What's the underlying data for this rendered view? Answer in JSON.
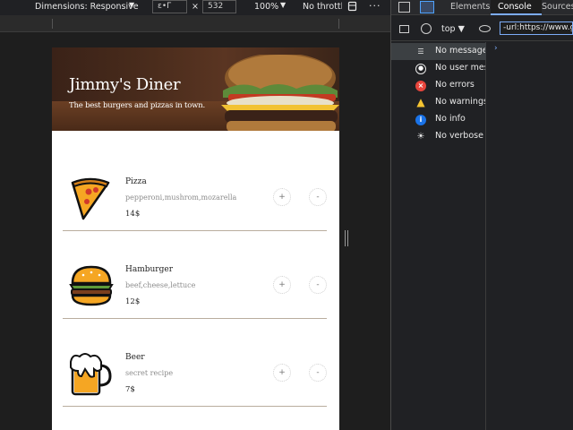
{
  "device_toolbar": {
    "dimensions_label": "Dimensions: Responsive",
    "width_value": "ε•Γ",
    "separator": "×",
    "height_value": "532",
    "zoom": "100%",
    "throttling": "No throttling"
  },
  "devtools": {
    "tabs": [
      "Elements",
      "Console",
      "Sources"
    ],
    "active_tab": "Console",
    "context": "top",
    "filter_value": "-url:https://www.goo",
    "sidebar": [
      {
        "label": "No messages",
        "icon": "list-icon",
        "color": "#e8e8e8"
      },
      {
        "label": "No user messages",
        "icon": "user-icon",
        "color": "#e8e8e8"
      },
      {
        "label": "No errors",
        "icon": "error-icon",
        "color": "#e8453c"
      },
      {
        "label": "No warnings",
        "icon": "warning-icon",
        "color": "#f5c431"
      },
      {
        "label": "No info",
        "icon": "info-icon",
        "color": "#1a73e8"
      },
      {
        "label": "No verbose",
        "icon": "bug-icon",
        "color": "#e8e8e8"
      }
    ],
    "console_prompt": "›"
  },
  "page": {
    "title": "Jimmy's Diner",
    "subtitle": "The best burgers and pizzas in town.",
    "items": [
      {
        "name": "Pizza",
        "ingredients": "pepperoni,mushrom,mozarella",
        "price": "14$",
        "icon": "pizza-icon"
      },
      {
        "name": "Hamburger",
        "ingredients": "beef,cheese,lettuce",
        "price": "12$",
        "icon": "hamburger-icon"
      },
      {
        "name": "Beer",
        "ingredients": "secret recipe",
        "price": "7$",
        "icon": "beer-icon"
      }
    ],
    "add_label": "+",
    "remove_label": "-"
  }
}
